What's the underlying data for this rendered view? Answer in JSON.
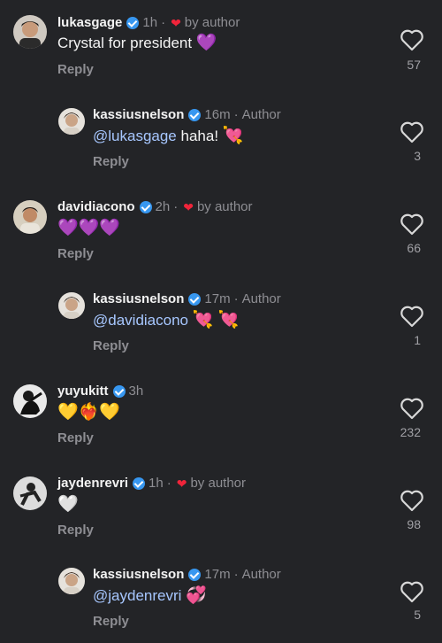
{
  "comments": [
    {
      "username": "lukasgage",
      "time": "1h",
      "tag": "by author",
      "text": "Crystal for president",
      "emoji": "💜",
      "reply": "Reply",
      "likes": "57"
    },
    {
      "username": "kassiusnelson",
      "time": "16m",
      "tag": "Author",
      "mention": "@lukasgage",
      "text": "haha!",
      "emoji": "💘",
      "reply": "Reply",
      "likes": "3"
    },
    {
      "username": "davidiacono",
      "time": "2h",
      "tag": "by author",
      "emoji": "💜💜💜",
      "reply": "Reply",
      "likes": "66"
    },
    {
      "username": "kassiusnelson",
      "time": "17m",
      "tag": "Author",
      "mention": "@davidiacono",
      "emoji": "💘 💘",
      "reply": "Reply",
      "likes": "1"
    },
    {
      "username": "yuyukitt",
      "time": "3h",
      "emoji": "💛❤️‍🔥💛",
      "reply": "Reply",
      "likes": "232"
    },
    {
      "username": "jaydenrevri",
      "time": "1h",
      "tag": "by author",
      "emoji": "🤍",
      "reply": "Reply",
      "likes": "98"
    },
    {
      "username": "kassiusnelson",
      "time": "17m",
      "tag": "Author",
      "mention": "@jaydenrevri",
      "emoji": "💞",
      "reply": "Reply",
      "likes": "5"
    }
  ],
  "separator": "·",
  "colors": {
    "background": "#232427",
    "verified": "#3797f0",
    "heart_red": "#f0243a",
    "mention": "#a7c7ff"
  }
}
